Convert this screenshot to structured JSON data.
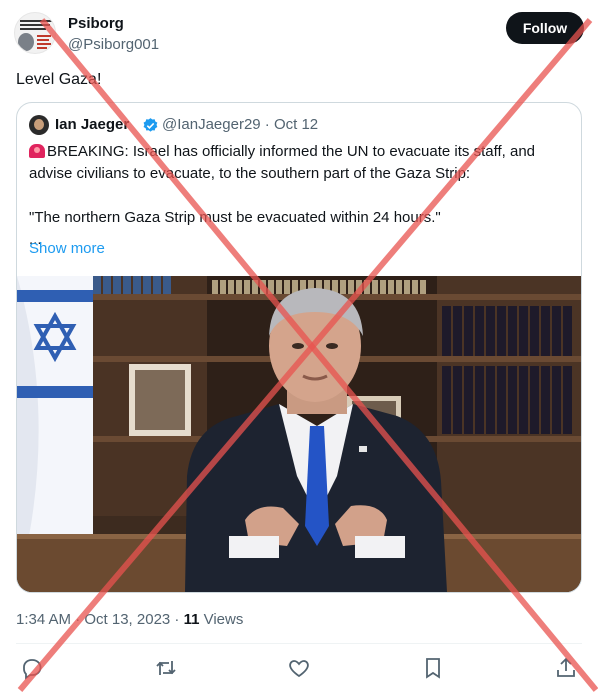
{
  "author": {
    "name": "Psiborg",
    "handle": "@Psiborg001",
    "follow_label": "Follow"
  },
  "tweet": {
    "text": "Level Gaza!"
  },
  "quote": {
    "name": "Ian Jaeger",
    "handle_date": "@IanJaeger29 · Oct 12",
    "line1": "BREAKING: Israel has officially informed the UN to evacuate its staff, and advise civilians to evacuate, to the southern part of the Gaza Strip:",
    "line2": "\"The northern Gaza Strip must be evacuated within 24 hours.\"",
    "ellipsis": "...",
    "show_more": "Show more"
  },
  "meta": {
    "time": "1:34 AM · Oct 13, 2023 · ",
    "views_count": "11",
    "views_label": " Views"
  },
  "icons": {
    "reply": "reply-icon",
    "repost": "repost-icon",
    "like": "like-icon",
    "bookmark": "bookmark-icon",
    "share": "share-icon"
  },
  "colors": {
    "accent": "#1d9bf0",
    "overlay_x": "#e8534f"
  }
}
